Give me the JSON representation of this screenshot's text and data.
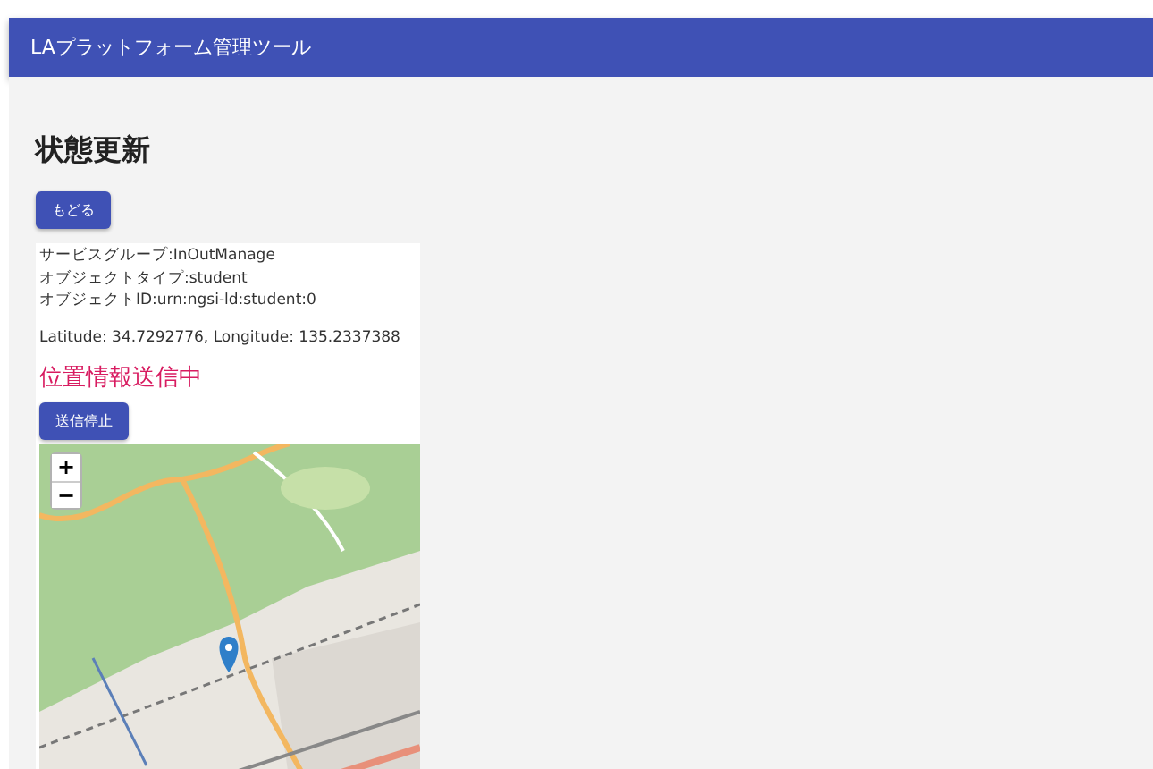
{
  "app_bar": {
    "title": "LAプラットフォーム管理ツール"
  },
  "page_title": "状態更新",
  "back_button": "もどる",
  "info": {
    "lines": [
      "サービスグループ:InOutManage",
      "オブジェクトタイプ:student",
      "オブジェクトID:urn:ngsi-ld:student:0"
    ],
    "coordinates": "Latitude: 34.7292776, Longitude: 135.2337388",
    "status": "位置情報送信中",
    "stop_button": "送信停止"
  },
  "map": {
    "kind": "picture",
    "zoom_in": "+",
    "zoom_out": "−"
  }
}
